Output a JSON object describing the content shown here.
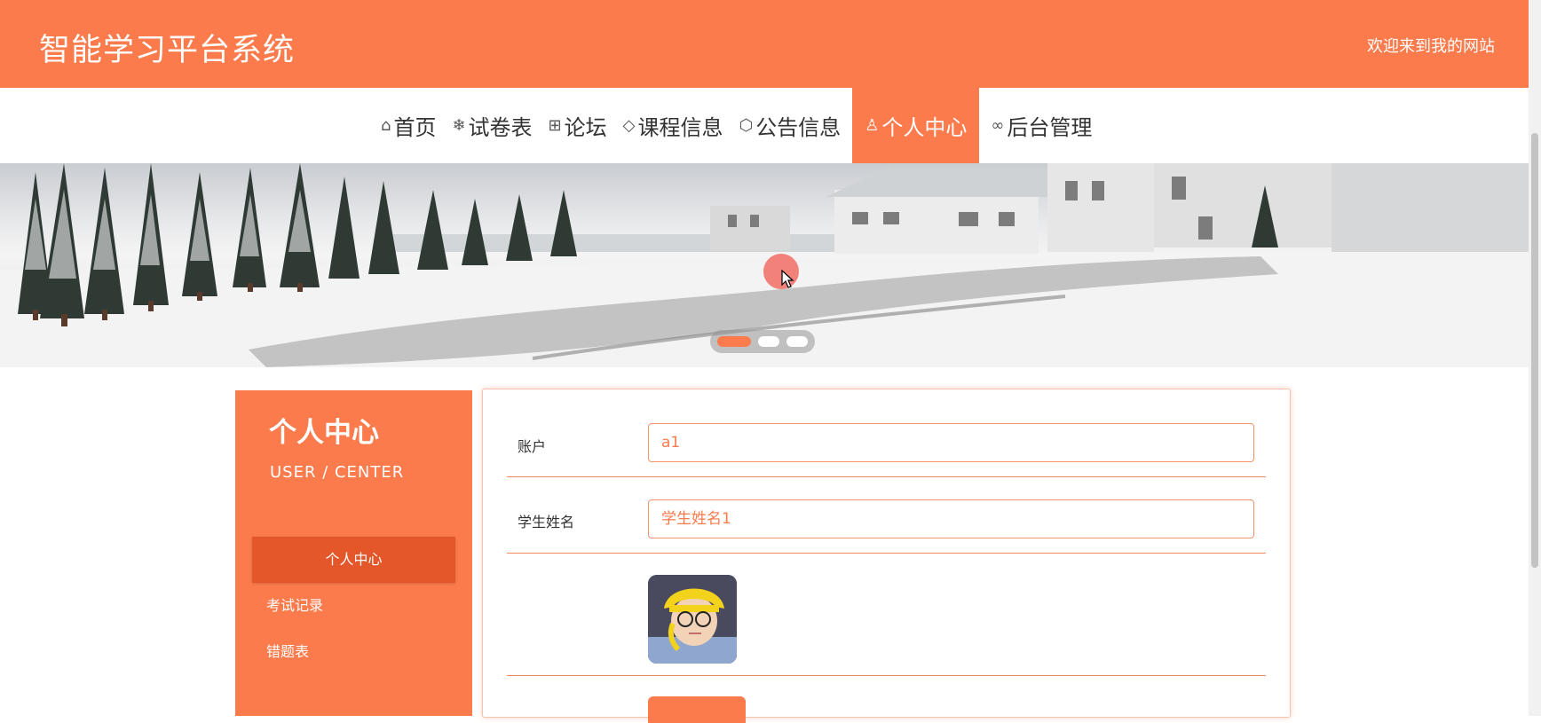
{
  "header": {
    "site_title": "智能学习平台系统",
    "welcome": "欢迎来到我的网站"
  },
  "nav": {
    "items": [
      {
        "label": "首页",
        "icon": "home-icon",
        "glyph": "⌂"
      },
      {
        "label": "试卷表",
        "icon": "snowflake-icon",
        "glyph": "❄"
      },
      {
        "label": "论坛",
        "icon": "gift-icon",
        "glyph": "⊞"
      },
      {
        "label": "课程信息",
        "icon": "tag-icon",
        "glyph": "◇"
      },
      {
        "label": "公告信息",
        "icon": "cube-icon",
        "glyph": "⬡"
      },
      {
        "label": "个人中心",
        "icon": "user-icon",
        "glyph": "♙"
      },
      {
        "label": "后台管理",
        "icon": "link-icon",
        "glyph": "∞"
      }
    ],
    "active_index": 5
  },
  "banner": {
    "dots": 3,
    "active_dot": 0
  },
  "sidebar": {
    "title": "个人中心",
    "subtitle": "USER / CENTER",
    "items": [
      {
        "label": "个人中心"
      },
      {
        "label": "考试记录"
      },
      {
        "label": "错题表"
      }
    ],
    "active_index": 0
  },
  "form": {
    "account_label": "账户",
    "account_value": "a1",
    "name_label": "学生姓名",
    "name_value": "学生姓名1"
  },
  "colors": {
    "accent": "#fb7b4d",
    "accent_dark": "#e4572a",
    "border": "#f08a62"
  }
}
